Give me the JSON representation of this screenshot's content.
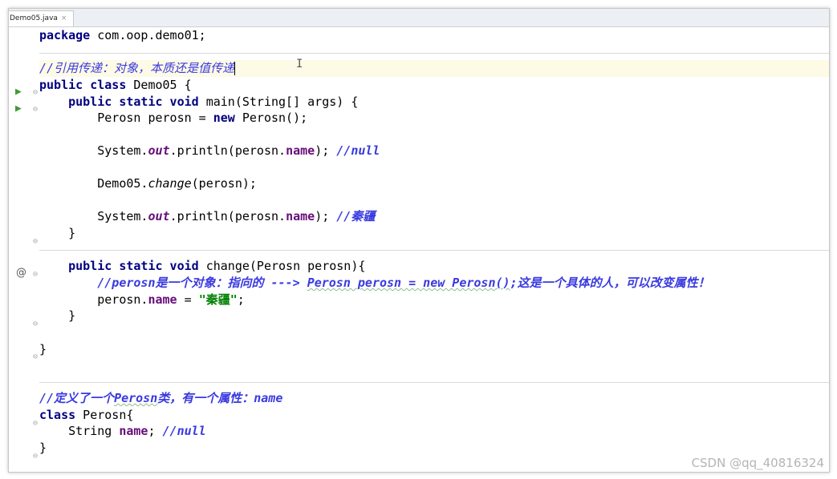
{
  "tab": {
    "filename": "Demo05.java",
    "close": "×"
  },
  "code": {
    "l1_kw": "package",
    "l1_rest": " com.oop.demo01;",
    "l3_comment": "//引用传递：对象，本质还是值传递",
    "l4_kw": "public class",
    "l4_rest": " Demo05 {",
    "l5_kw": "public static void",
    "l5_rest": " main(String[] args) {",
    "l6_a": "Perosn perosn = ",
    "l6_kw": "new",
    "l6_b": " Perosn();",
    "l8_a": "System.",
    "l8_out": "out",
    "l8_b": ".println(perosn.",
    "l8_name": "name",
    "l8_c": "); ",
    "l8_cmt": "//null",
    "l10_a": "Demo05.",
    "l10_change": "change",
    "l10_b": "(perosn);",
    "l12_a": "System.",
    "l12_out": "out",
    "l12_b": ".println(perosn.",
    "l12_name": "name",
    "l12_c": "); ",
    "l12_cmt": "//秦疆",
    "l13": "}",
    "l15_kw": "public static void",
    "l15_rest": " change(Perosn perosn){",
    "l16_c1": "//perosn是一个对象：指向的 ---> ",
    "l16_c2": "Perosn perosn = new Perosn()",
    "l16_c3": ";这是一个具体的人，可以改变属性！",
    "l17_a": "perosn.",
    "l17_name": "name",
    "l17_b": " = ",
    "l17_str": "\"秦疆\"",
    "l17_c": ";",
    "l18": "}",
    "l20": "}",
    "l23_c1": "//定义了一个",
    "l23_c2": "Perosn",
    "l23_c3": "类，有一个属性：name",
    "l24_kw": "class",
    "l24_rest": " Perosn{",
    "l25_a": "String ",
    "l25_name": "name",
    "l25_b": "; ",
    "l25_cmt": "//null",
    "l26": "}"
  },
  "gutter": {
    "run_glyph": "▶",
    "fold_glyph": "⊖",
    "override_glyph": "@"
  },
  "cursor_glyph": "I",
  "watermark": "CSDN @qq_40816324",
  "colors": {
    "keyword": "#000080",
    "field": "#660e7a",
    "comment": "#3a3ae0",
    "string": "#008000",
    "run": "#3d9b35",
    "caret_line": "#fdfae6"
  }
}
